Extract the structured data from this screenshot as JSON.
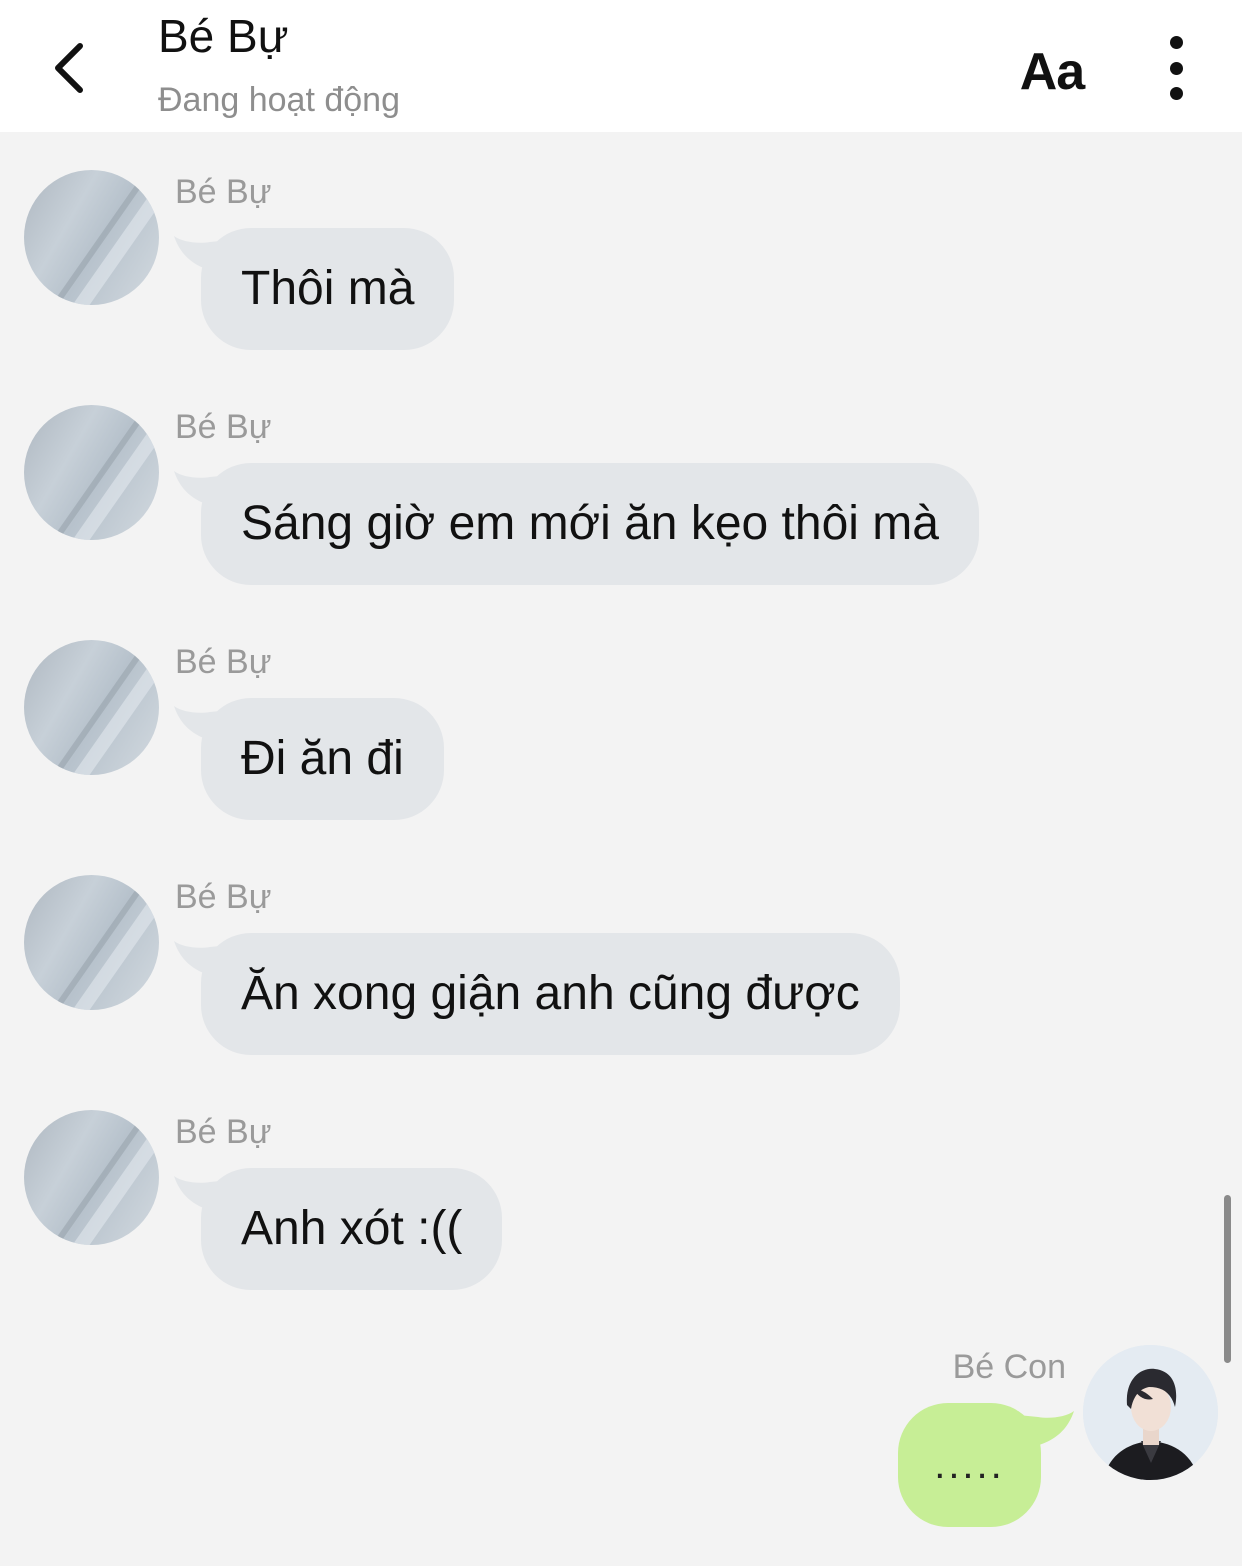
{
  "header": {
    "title": "Bé Bự",
    "status": "Đang hoạt động",
    "font_button": "Aa"
  },
  "messages": [
    {
      "sender": "Bé Bự",
      "text": "Thôi mà"
    },
    {
      "sender": "Bé Bự",
      "text": "Sáng giờ em mới ăn kẹo thôi mà"
    },
    {
      "sender": "Bé Bự",
      "text": "Đi ăn đi"
    },
    {
      "sender": "Bé Bự",
      "text": "Ăn xong giận anh cũng được"
    },
    {
      "sender": "Bé Bự",
      "text": "Anh xót :(("
    }
  ],
  "my_message": {
    "sender": "Bé Con",
    "text": "....."
  },
  "colors": {
    "incoming_bubble": "#e3e6e9",
    "outgoing_bubble": "#c7ee96",
    "background": "#f3f3f3"
  }
}
